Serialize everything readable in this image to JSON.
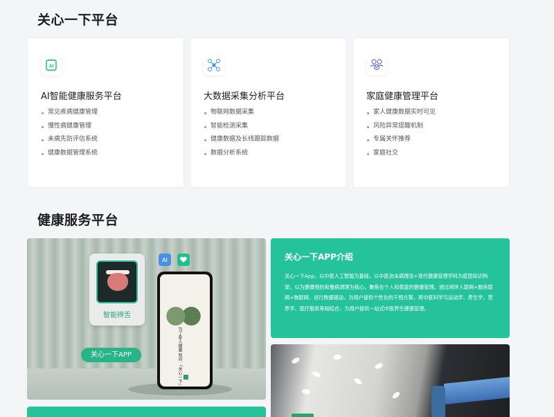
{
  "section1": {
    "title": "关心一下平台",
    "cards": [
      {
        "icon": "ai-chip-icon",
        "title": "AI智能健康服务平台",
        "items": [
          "常见疾病健康管理",
          "慢性病健康管理",
          "未病先防评估系统",
          "健康数据管理系统"
        ]
      },
      {
        "icon": "network-nodes-icon",
        "title": "大数据采集分析平台",
        "items": [
          "物联网数据采集",
          "智能检测采集",
          "健康数据及长线跟踪数据",
          "数据分析系统"
        ]
      },
      {
        "icon": "family-icon",
        "title": "家庭健康管理平台",
        "items": [
          "家人健康数据实时可见",
          "风险异常提醒机制",
          "专属关怀推荐",
          "家庭社交"
        ]
      }
    ]
  },
  "section2": {
    "title": "健康服务平台",
    "promo": {
      "tongue_label": "智能辨舌",
      "app_pill": "关心一下APP",
      "ai_badge": "AI",
      "phone_text": "为了家人健康 就问 「关心一下」"
    },
    "intro": {
      "title": "关心一下APP介绍",
      "body": "关心一下App，以中医人工智能为基础，以中医治未病理念+现代健康管理学科为底层知识构架，以为健康预防和慢病调理为核心，聚焦在个人和家庭的健康管理。通过闭环人联网+服务联网+物联网，进行数据驱动，为用户提供个性化的干预方案，将中医科学与运动学、养生学、营养学、医疗服务等相结合，为用户提供一站式中医养生健康管理。"
    }
  },
  "colors": {
    "accent": "#25c39b",
    "pill": "#27b487"
  }
}
